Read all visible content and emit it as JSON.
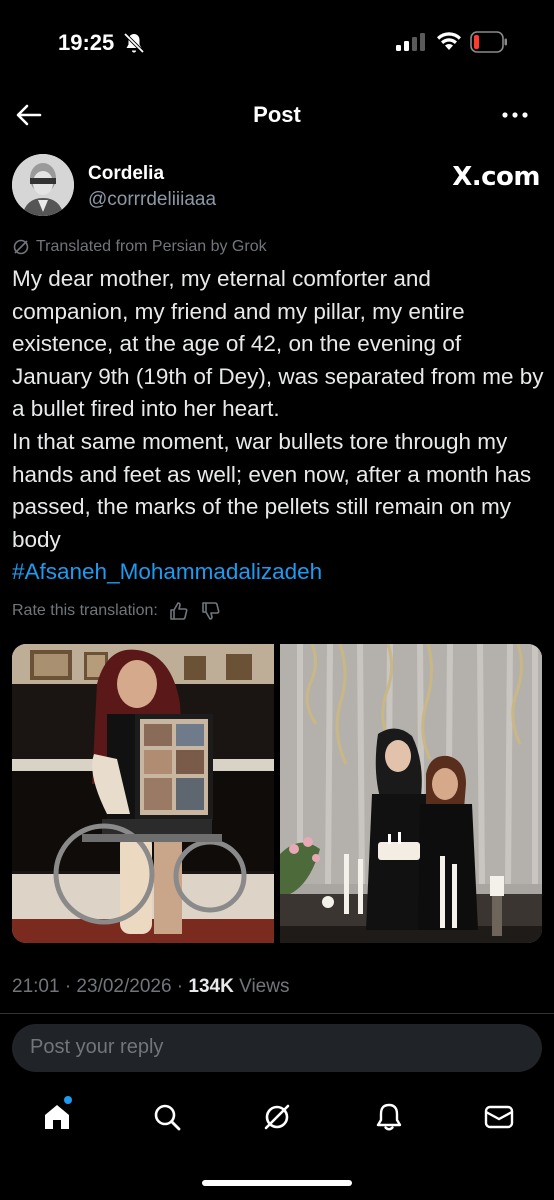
{
  "status_bar": {
    "time": "19:25"
  },
  "nav": {
    "title": "Post"
  },
  "author": {
    "name": "Cordelia",
    "handle": "@corrrdeliiiaaa",
    "badge": "X.com"
  },
  "post": {
    "translation_note": "Translated from Persian by Grok",
    "text": "My dear mother, my eternal comforter and companion, my friend and my pillar, my entire existence, at the age of 42, on the evening of January 9th (19th of Dey), was separated from me by a bullet fired into her heart.\nIn that same moment, war bullets tore through my hands and feet as well; even now, after a month has passed, the marks of the pellets still remain on my body",
    "hashtag": "#Afsaneh_Mohammadalizadeh",
    "rate_label": "Rate this translation:",
    "timestamp": "21:01 · 23/02/2026 · ",
    "views_count": "134K",
    "views_label": " Views"
  },
  "reply": {
    "placeholder": "Post your reply"
  },
  "tabs": [
    {
      "icon": "home-icon",
      "active": true
    },
    {
      "icon": "search-icon"
    },
    {
      "icon": "grok-icon"
    },
    {
      "icon": "bell-icon"
    },
    {
      "icon": "mail-icon"
    }
  ],
  "colors": {
    "background": "#000000",
    "text": "#e7e9ea",
    "secondary": "#71767b",
    "link": "#1d9bf0",
    "battery_low": "#ff3b30"
  }
}
